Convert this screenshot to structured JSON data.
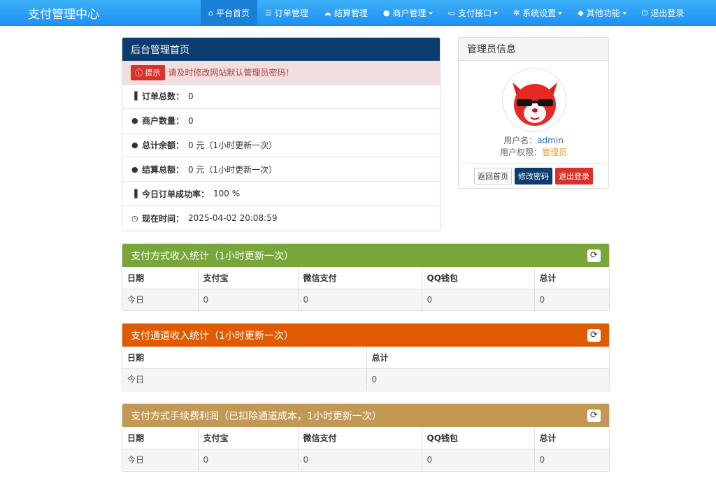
{
  "brand": "支付管理中心",
  "nav": [
    {
      "icon": "home-icon",
      "glyph": "⌂",
      "label": "平台首页",
      "active": true
    },
    {
      "icon": "list-icon",
      "glyph": "☰",
      "label": "订单管理"
    },
    {
      "icon": "cloud-icon",
      "glyph": "☁",
      "label": "结算管理"
    },
    {
      "icon": "user-icon",
      "glyph": "👤",
      "label": "商户管理"
    },
    {
      "icon": "card-icon",
      "glyph": "▭",
      "label": "支付接口"
    },
    {
      "icon": "gear-icon",
      "glyph": "✻",
      "label": "系统设置"
    },
    {
      "icon": "cube-icon",
      "glyph": "◆",
      "label": "其他功能"
    },
    {
      "icon": "power-icon",
      "glyph": "⏻",
      "label": "退出登录"
    }
  ],
  "home": {
    "title": "后台管理首页",
    "alert_tag": "提示",
    "alert_text": "请及时修改网站默认管理员密码！",
    "rows": [
      {
        "label": "订单总数：",
        "value": "0"
      },
      {
        "label": "商户数量：",
        "value": "0"
      },
      {
        "label": "总计余额：",
        "value": "0 元（1小时更新一次）"
      },
      {
        "label": "结算总额：",
        "value": "0 元（1小时更新一次）"
      },
      {
        "label": "今日订单成功率：",
        "value": "100 %"
      },
      {
        "label": "现在时间：",
        "value": "2025-04-02 20:08:59"
      }
    ]
  },
  "admin": {
    "title": "管理员信息",
    "username_label": "用户名：",
    "username": "admin",
    "role_label": "用户权限：",
    "role": "管理员",
    "btn_home": "返回首页",
    "btn_password": "修改密码",
    "btn_logout": "退出登录"
  },
  "pay_stats": {
    "title": "支付方式收入统计（1小时更新一次）",
    "headers": [
      "日期",
      "支付宝",
      "微信支付",
      "QQ钱包",
      "总计"
    ],
    "row": [
      "今日",
      "0",
      "0",
      "0",
      "0"
    ]
  },
  "channel_stats": {
    "title": "支付通道收入统计（1小时更新一次）",
    "headers": [
      "日期",
      "总计"
    ],
    "row": [
      "今日",
      "0"
    ]
  },
  "fee_stats": {
    "title": "支付方式手续费利润（已扣除通道成本，1小时更新一次）",
    "headers": [
      "日期",
      "支付宝",
      "微信支付",
      "QQ钱包",
      "总计"
    ],
    "row": [
      "今日",
      "0",
      "0",
      "0",
      "0"
    ]
  }
}
